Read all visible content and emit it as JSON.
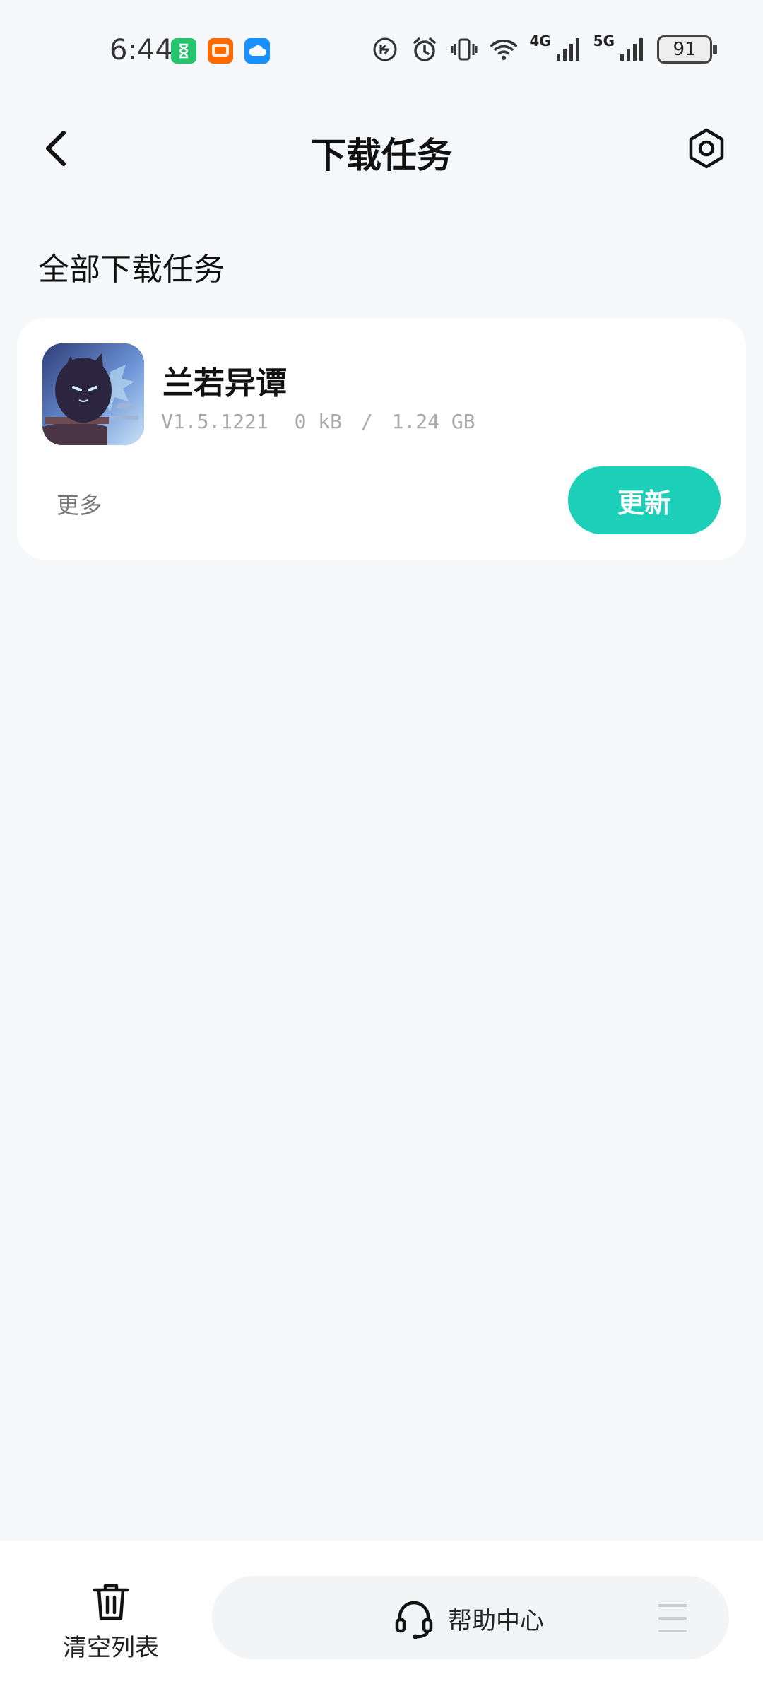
{
  "status_bar": {
    "time": "6:44",
    "network_4g_label": "4G",
    "network_5g_label": "5G",
    "battery": "91"
  },
  "header": {
    "title": "下载任务"
  },
  "section": {
    "title": "全部下载任务"
  },
  "task": {
    "app_name": "兰若异谭",
    "version": "V1.5.1221",
    "downloaded": "0 kB",
    "separator": "/",
    "total": "1.24 GB",
    "more_label": "更多",
    "update_label": "更新"
  },
  "bottom_bar": {
    "clear_label": "清空列表",
    "help_label": "帮助中心"
  },
  "colors": {
    "accent": "#1ccfb8",
    "background": "#f6f7f9"
  }
}
